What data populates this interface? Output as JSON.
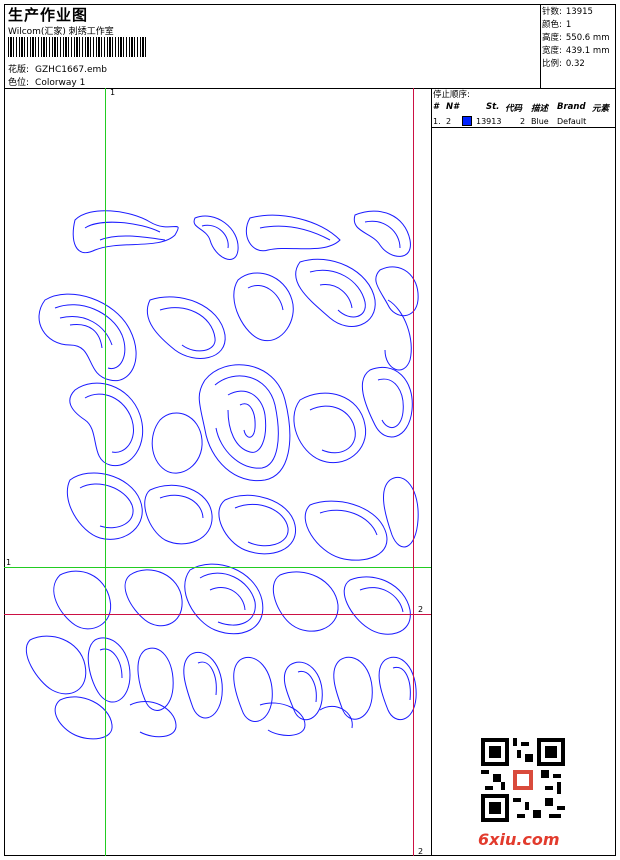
{
  "header": {
    "title": "生产作业图",
    "company": "Wilcom(汇家) 刺绣工作室",
    "design_label": "花版:",
    "design_value": "GZHC1667.emb",
    "colorway_label": "色位:",
    "colorway_value": "Colorway 1"
  },
  "stats": [
    {
      "label": "针数:",
      "value": "13915"
    },
    {
      "label": "颜色:",
      "value": "1"
    },
    {
      "label": "高度:",
      "value": "550.6 mm"
    },
    {
      "label": "宽度:",
      "value": "439.1 mm"
    },
    {
      "label": "比例:",
      "value": "0.32"
    }
  ],
  "stop_sequence": {
    "title": "停止顺序:",
    "columns": [
      "#",
      "N#",
      "St.",
      "代码",
      "描述",
      "Brand",
      "元素"
    ],
    "rows": [
      {
        "num": "1.",
        "needle": "2",
        "stitches": "13913",
        "code": "2",
        "desc": "Blue",
        "brand": "Default",
        "color": "#0022ff"
      }
    ]
  },
  "guides": {
    "green_label": "1",
    "red_label": "2"
  },
  "watermark": {
    "text": "6xiu.com",
    "color": "#e23b2d"
  },
  "stitch_color": "#1a1aff"
}
